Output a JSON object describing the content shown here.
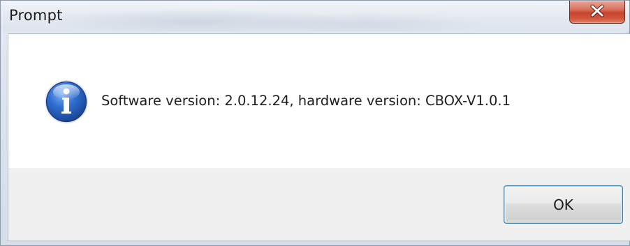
{
  "window": {
    "title": "Prompt",
    "close_icon": "close-x-icon"
  },
  "dialog": {
    "icon": "info-icon",
    "message": "Software version: 2.0.12.24, hardware version: CBOX-V1.0.1"
  },
  "buttons": {
    "ok_label": "OK"
  },
  "colors": {
    "close_button": "#c8442b",
    "info_icon": "#1f5fb8",
    "ok_focus_border": "#3c7fb1"
  }
}
